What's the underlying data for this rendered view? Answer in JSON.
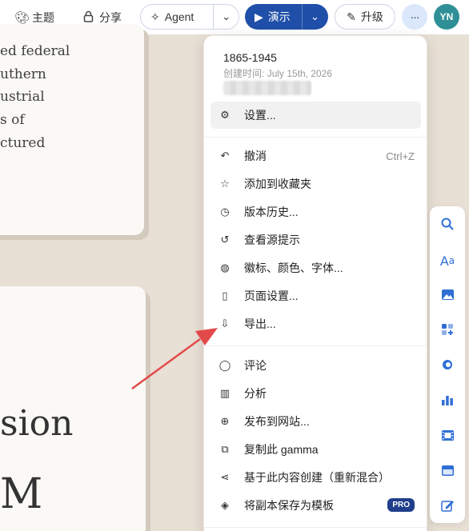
{
  "topbar": {
    "theme_label": "主题",
    "share_label": "分享",
    "agent_label": "Agent",
    "present_label": "演示",
    "upgrade_label": "升级",
    "more_label": "···",
    "avatar_initials": "YN"
  },
  "canvas": {
    "card1_lines": [
      "ed federal",
      "uthern",
      "ustrial",
      "s of",
      "ctured"
    ],
    "card2_big_word": "sion",
    "card2_big_letter": "M"
  },
  "menu": {
    "title": "1865-1945",
    "created_label": "创建时间:",
    "created_date": "July 15th, 2026",
    "items": [
      {
        "label": "设置...",
        "icon": "gear-icon",
        "shortcut": ""
      },
      {
        "label": "撤消",
        "icon": "undo-icon",
        "shortcut": "Ctrl+Z"
      },
      {
        "label": "添加到收藏夹",
        "icon": "star-icon",
        "shortcut": ""
      },
      {
        "label": "版本历史...",
        "icon": "clock-icon",
        "shortcut": ""
      },
      {
        "label": "查看源提示",
        "icon": "history-icon",
        "shortcut": ""
      },
      {
        "label": "徽标、颜色、字体...",
        "icon": "palette-icon",
        "shortcut": ""
      },
      {
        "label": "页面设置...",
        "icon": "page-icon",
        "shortcut": ""
      },
      {
        "label": "导出...",
        "icon": "export-icon",
        "shortcut": ""
      },
      {
        "label": "评论",
        "icon": "comment-icon",
        "shortcut": ""
      },
      {
        "label": "分析",
        "icon": "analytics-icon",
        "shortcut": ""
      },
      {
        "label": "发布到网站...",
        "icon": "globe-icon",
        "shortcut": ""
      },
      {
        "label": "复制此 gamma",
        "icon": "copy-icon",
        "shortcut": ""
      },
      {
        "label": "基于此内容创建（重新混合）",
        "icon": "remix-icon",
        "shortcut": ""
      },
      {
        "label": "将副本保存为模板",
        "icon": "stack-icon",
        "shortcut": "",
        "badge": "PRO"
      }
    ]
  },
  "right_toolbar": [
    "search-icon",
    "text-style-icon",
    "image-icon",
    "add-block-icon",
    "toggle-icon",
    "chart-icon",
    "film-icon",
    "layout-icon",
    "edit-icon"
  ],
  "colors": {
    "present_button": "#1f4fa8",
    "avatar": "#2f8f96",
    "accent_icon": "#2f6fd6",
    "arrow": "#e24a4a",
    "canvas_bg": "#e8dfd5"
  }
}
